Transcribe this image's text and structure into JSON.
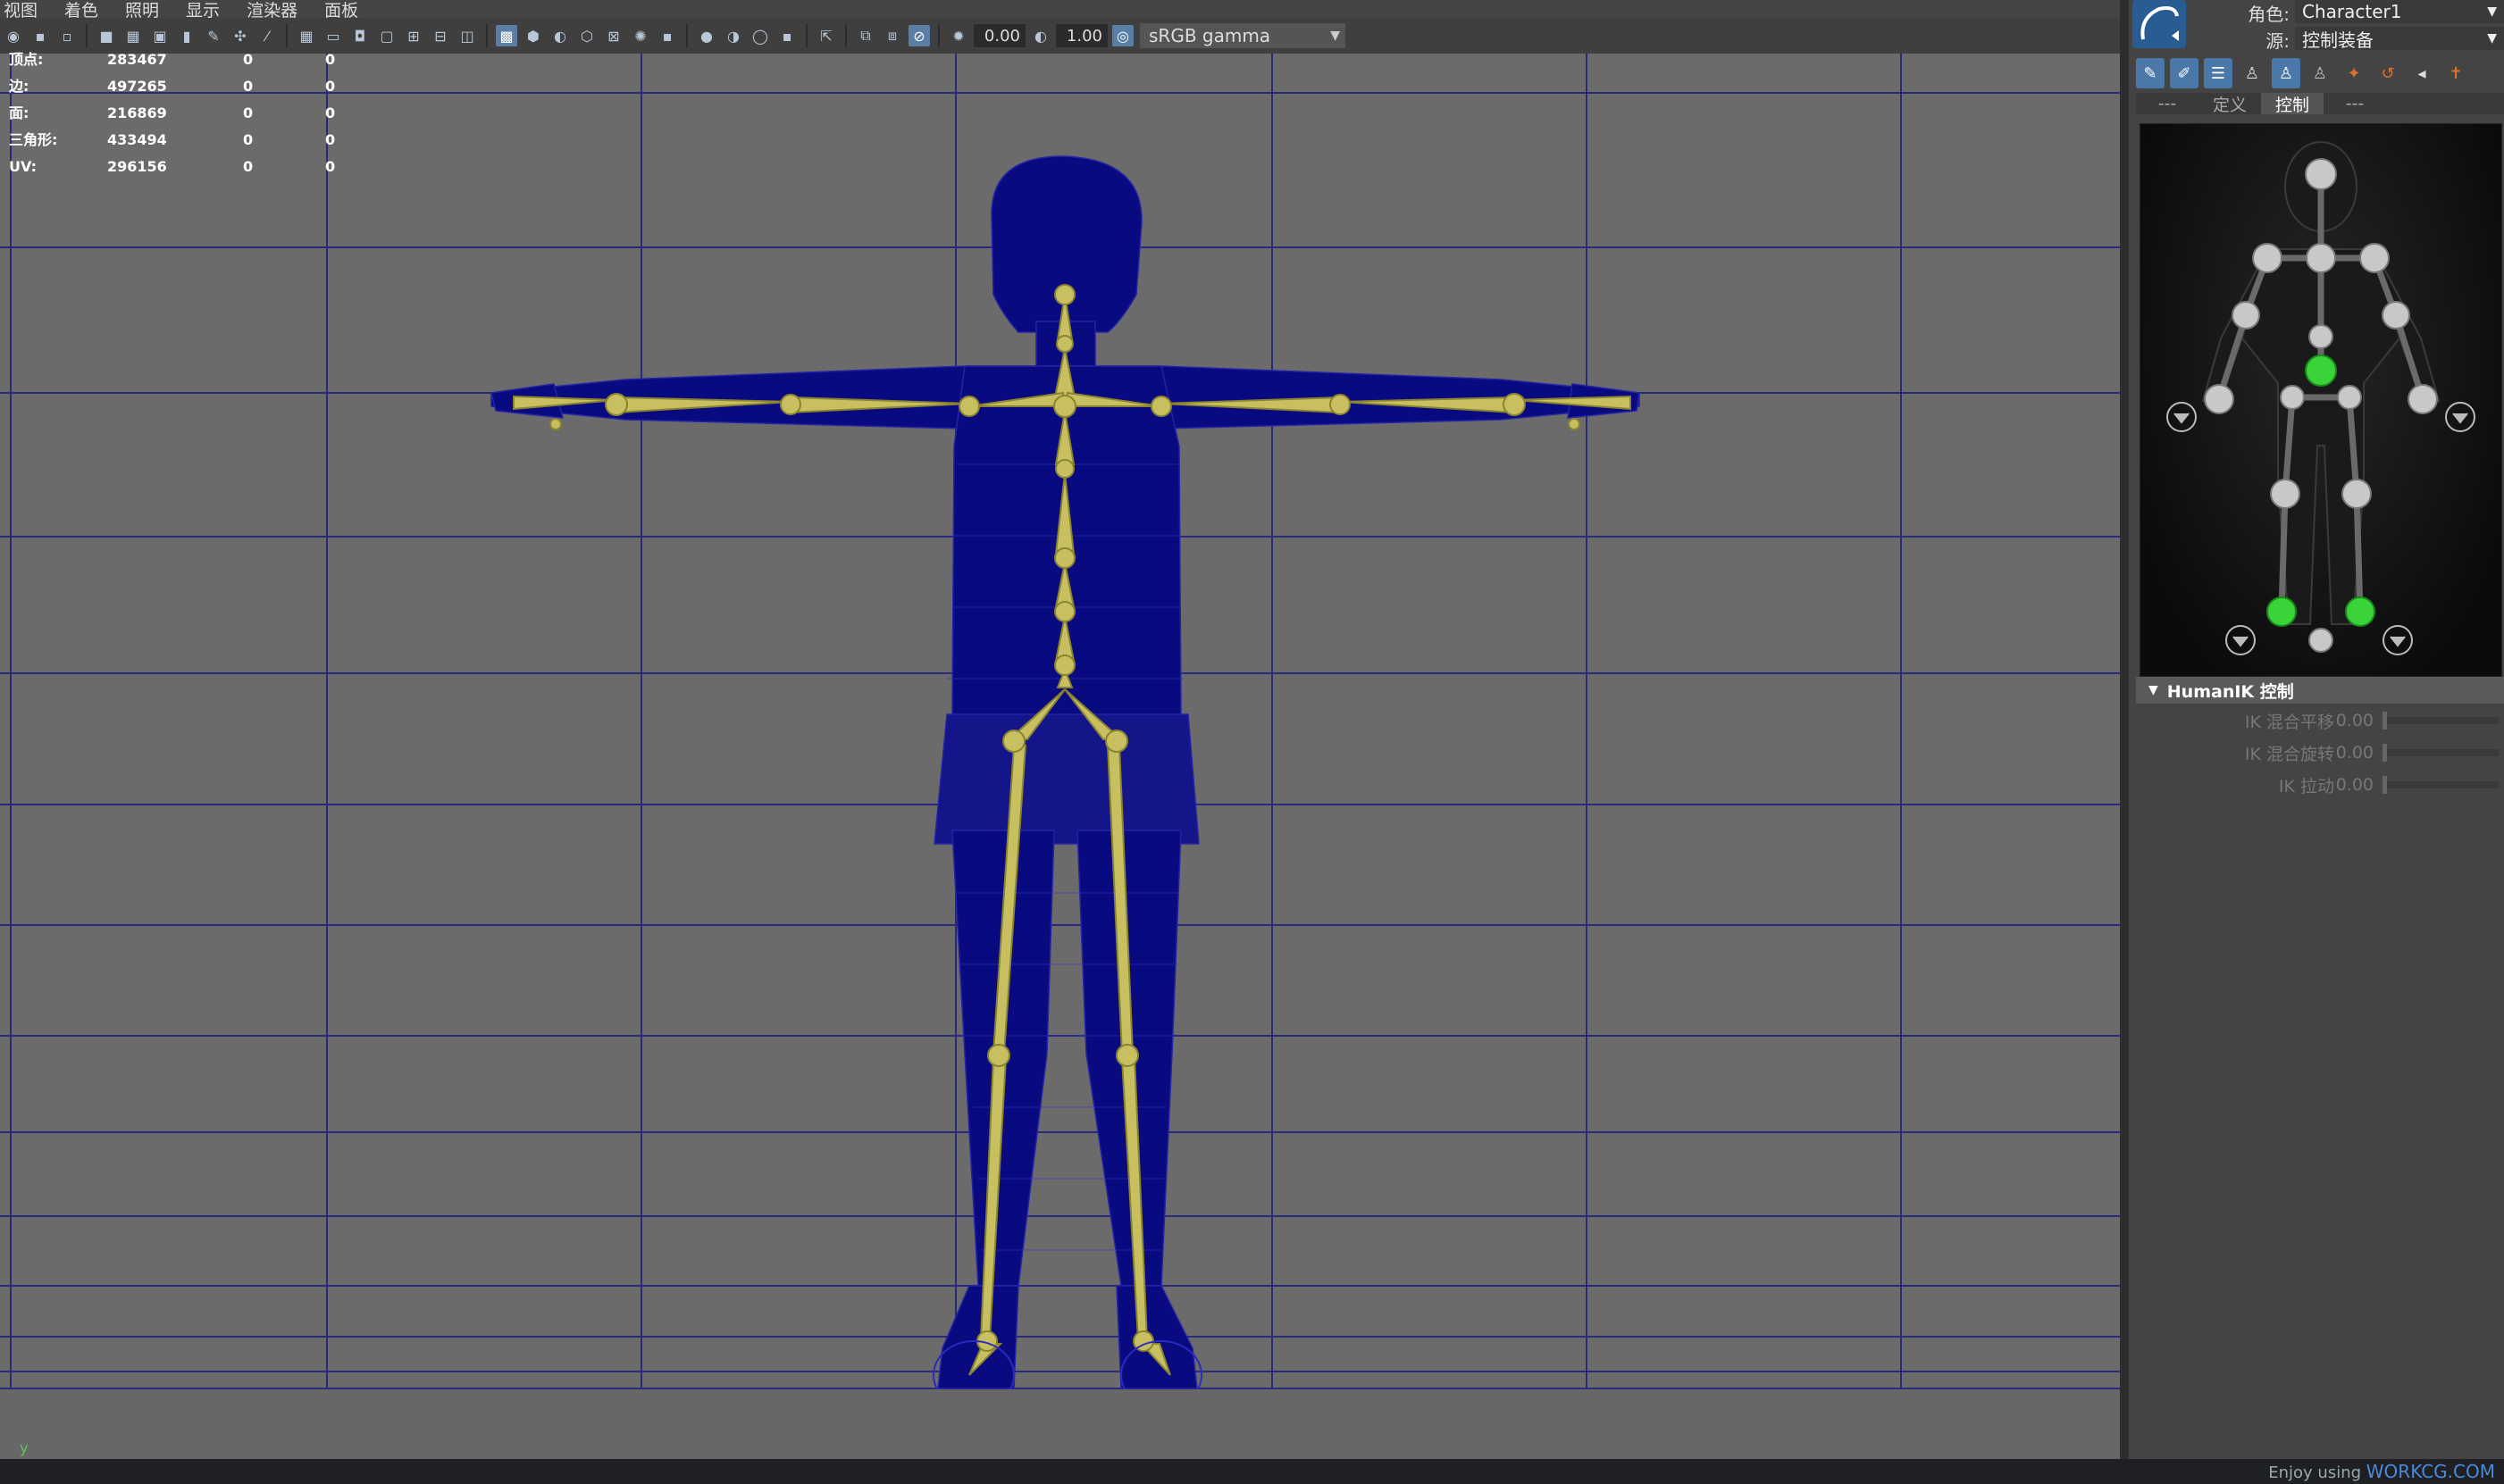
{
  "menu": [
    "视图",
    "着色",
    "照明",
    "显示",
    "渲染器",
    "面板"
  ],
  "toolbar": {
    "value1": "0.00",
    "value2": "1.00",
    "color_space": "sRGB gamma"
  },
  "hud": {
    "rows": [
      {
        "label": "顶点:",
        "value": "283467",
        "v2": "0",
        "v3": "0"
      },
      {
        "label": "边:",
        "value": "497265",
        "v2": "0",
        "v3": "0"
      },
      {
        "label": "面:",
        "value": "216869",
        "v2": "0",
        "v3": "0"
      },
      {
        "label": "三角形:",
        "value": "433494",
        "v2": "0",
        "v3": "0"
      },
      {
        "label": "UV:",
        "value": "296156",
        "v2": "0",
        "v3": "0"
      }
    ]
  },
  "axis": {
    "y_label": "y"
  },
  "panel": {
    "character_label": "角色:",
    "character_value": "Character1",
    "source_label": "源:",
    "source_value": "控制装备",
    "tabs": [
      "---",
      "定义",
      "控制",
      "---"
    ],
    "active_tab": 2,
    "section_title": "HumanIK 控制",
    "sliders": [
      {
        "label": "IK 混合平移",
        "value": "0.00"
      },
      {
        "label": "IK 混合旋转",
        "value": "0.00"
      },
      {
        "label": "IK 拉动",
        "value": "0.00"
      }
    ]
  },
  "watermark": {
    "prefix": "Enjoy using",
    "site": "WORKCG.COM"
  },
  "colors": {
    "viewport_bg": "#6b6b6b",
    "grid_line": "#2a2a7a",
    "mesh": "#0a0a80",
    "bone": "#c8c060",
    "effector_active": "#3ad33a",
    "accent_blue": "#4a78a8"
  }
}
